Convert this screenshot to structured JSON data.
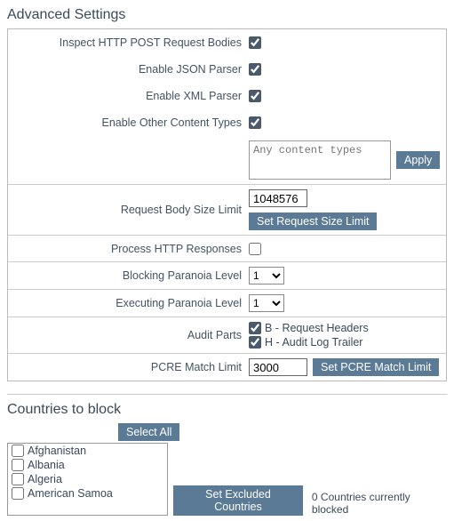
{
  "advanced": {
    "title": "Advanced Settings",
    "inspect_post_label": "Inspect HTTP POST Request Bodies",
    "inspect_post_checked": true,
    "json_parser_label": "Enable JSON Parser",
    "json_parser_checked": true,
    "xml_parser_label": "Enable XML Parser",
    "xml_parser_checked": true,
    "other_types_label": "Enable Other Content Types",
    "other_types_checked": true,
    "content_types_placeholder": "Any content types",
    "content_types_value": "",
    "apply_label": "Apply",
    "req_size_label": "Request Body Size Limit",
    "req_size_value": "1048576",
    "req_size_btn": "Set Request Size Limit",
    "process_resp_label": "Process HTTP Responses",
    "process_resp_checked": false,
    "blocking_label": "Blocking Paranoia Level",
    "blocking_value": "1",
    "executing_label": "Executing Paranoia Level",
    "executing_value": "1",
    "audit_label": "Audit Parts",
    "audit_b_checked": true,
    "audit_b_text": "B - Request Headers",
    "audit_h_checked": true,
    "audit_h_text": "H - Audit Log Trailer",
    "pcre_label": "PCRE Match Limit",
    "pcre_value": "3000",
    "pcre_btn": "Set PCRE Match Limit"
  },
  "countries": {
    "title": "Countries to block",
    "select_all": "Select All",
    "list": [
      {
        "name": "Afghanistan",
        "checked": false
      },
      {
        "name": "Albania",
        "checked": false
      },
      {
        "name": "Algeria",
        "checked": false
      },
      {
        "name": "American Samoa",
        "checked": false
      }
    ],
    "set_excluded_btn": "Set Excluded Countries",
    "status": "0 Countries currently blocked"
  }
}
